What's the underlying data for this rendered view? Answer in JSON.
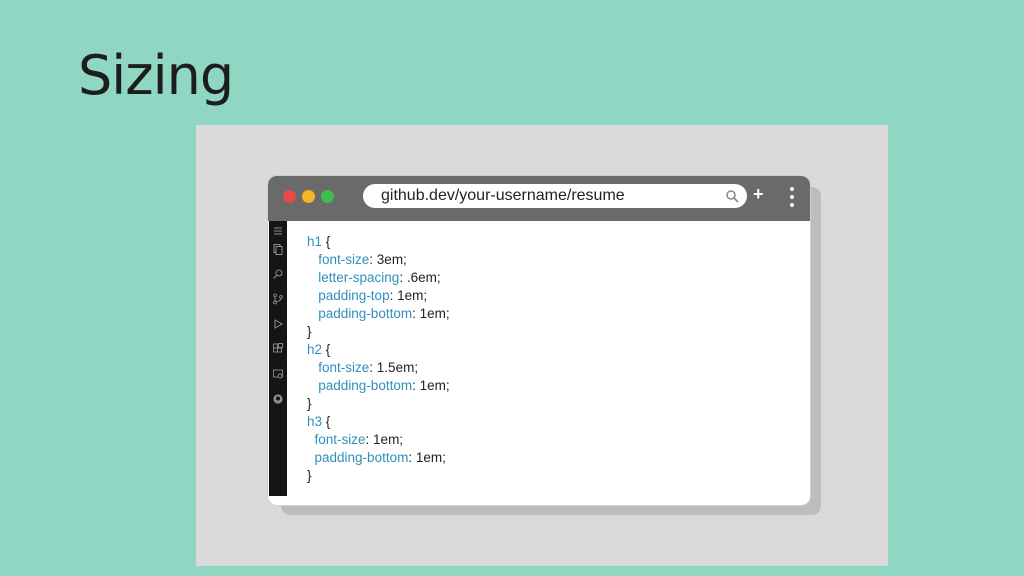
{
  "slide": {
    "title": "Sizing"
  },
  "browser": {
    "address": "github.dev/your-username/resume",
    "plus_label": "+"
  },
  "code": [
    {
      "indent": "",
      "sel": "h1",
      "rest": " {"
    },
    {
      "indent": "   ",
      "prop": "font-size",
      "rest": ": 3em;"
    },
    {
      "indent": "   ",
      "prop": "letter-spacing",
      "rest": ": .6em;"
    },
    {
      "indent": "   ",
      "prop": "padding-top",
      "rest": ": 1em;"
    },
    {
      "indent": "   ",
      "prop": "padding-bottom",
      "rest": ": 1em;"
    },
    {
      "indent": "",
      "rest": "}"
    },
    {
      "indent": "",
      "sel": "h2",
      "rest": " {"
    },
    {
      "indent": "   ",
      "prop": "font-size",
      "rest": ": 1.5em;"
    },
    {
      "indent": "   ",
      "prop": "padding-bottom",
      "rest": ": 1em;"
    },
    {
      "indent": "",
      "rest": "}"
    },
    {
      "indent": "",
      "sel": "h3",
      "rest": " {"
    },
    {
      "indent": "  ",
      "prop": "font-size",
      "rest": ": 1em;"
    },
    {
      "indent": "  ",
      "prop": "padding-bottom",
      "rest": ": 1em;"
    },
    {
      "indent": "",
      "rest": "}"
    }
  ],
  "activity_icons": [
    "menu-icon",
    "explorer-icon",
    "search-icon",
    "source-control-icon",
    "run-debug-icon",
    "extensions-icon",
    "remote-explorer-icon",
    "github-icon"
  ]
}
